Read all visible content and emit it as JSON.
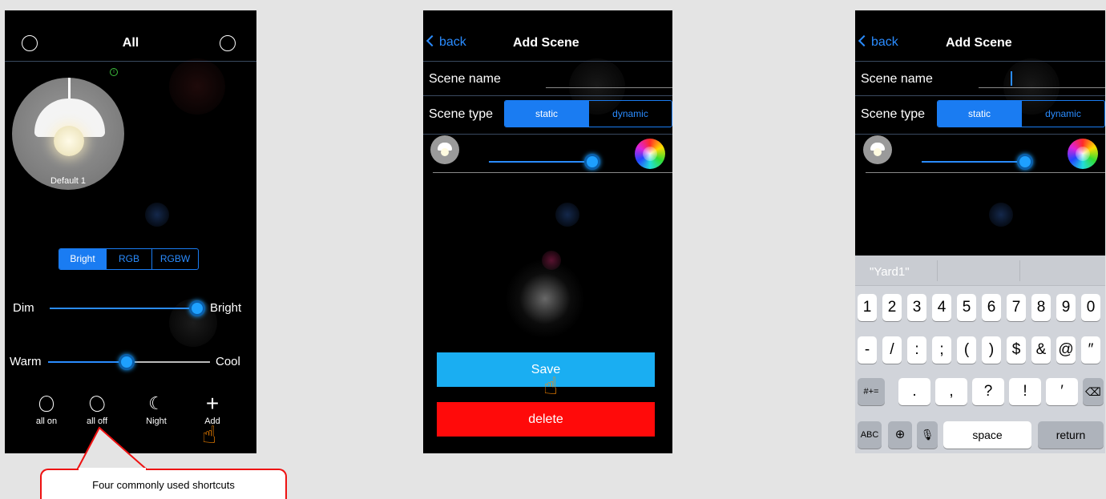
{
  "phone1": {
    "title": "All",
    "lamp_label": "Default 1",
    "info_badge": "i",
    "modes": [
      "Bright",
      "RGB",
      "RGBW"
    ],
    "active_mode": "Bright",
    "slider1": {
      "left": "Dim",
      "right": "Bright",
      "value": 0.89
    },
    "slider2": {
      "left": "Warm",
      "right": "Cool",
      "value": 0.5
    },
    "shortcuts": [
      {
        "label": "all on",
        "icon": "bulb-icon"
      },
      {
        "label": "all off",
        "icon": "bulb-off-icon"
      },
      {
        "label": "Night",
        "icon": "moon-icon"
      },
      {
        "label": "Add",
        "icon": "plus-icon"
      }
    ]
  },
  "phone2": {
    "back": "back",
    "title": "Add Scene",
    "scene_name_label": "Scene name",
    "scene_type_label": "Scene type",
    "scene_types": [
      "static",
      "dynamic"
    ],
    "active_type": "static",
    "brightness": 0.8,
    "save": "Save",
    "delete": "delete"
  },
  "phone3": {
    "back": "back",
    "title": "Add Scene",
    "scene_name_label": "Scene name",
    "scene_type_label": "Scene type",
    "scene_types": [
      "static",
      "dynamic"
    ],
    "active_type": "static",
    "brightness": 0.8,
    "suggestion": "\"Yard1\"",
    "keyboard": {
      "row1": [
        "1",
        "2",
        "3",
        "4",
        "5",
        "6",
        "7",
        "8",
        "9",
        "0"
      ],
      "row2": [
        "-",
        "/",
        ":",
        ";",
        "(",
        ")",
        "$",
        "&",
        "@",
        "″"
      ],
      "row3_mod": "#+=",
      "row3": [
        ".",
        ",",
        "?",
        "!",
        "′"
      ],
      "abc": "ABC",
      "space": "space",
      "return": "return"
    }
  },
  "callout": "Four commonly used shortcuts",
  "colors": {
    "accent": "#1a7cf2",
    "save": "#1aaef2",
    "delete": "#ff0a0a",
    "callout_border": "#ee1111"
  }
}
